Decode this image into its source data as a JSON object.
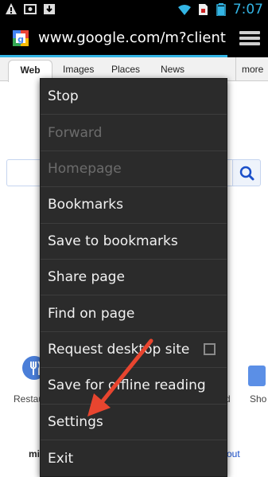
{
  "status_bar": {
    "time": "7:07",
    "icons": [
      "warning-icon",
      "photo-icon",
      "download-icon",
      "wifi-icon",
      "sim-icon",
      "battery-icon"
    ]
  },
  "url_bar": {
    "url": "www.google.com/m?client=ms",
    "favicon": "google-favicon-icon",
    "menu_icon": "overflow-menu-icon"
  },
  "google_tabs": {
    "items": [
      "Web",
      "Images",
      "Places",
      "News"
    ],
    "more": "more"
  },
  "background_text": {
    "left_label": "Restau",
    "right_label_1": "d",
    "right_label_2": "Sho",
    "bottom_left": "mi",
    "bottom_right": "out"
  },
  "menu": {
    "items": [
      {
        "label": "Stop",
        "enabled": true
      },
      {
        "label": "Forward",
        "enabled": false
      },
      {
        "label": "Homepage",
        "enabled": false
      },
      {
        "label": "Bookmarks",
        "enabled": true
      },
      {
        "label": "Save to bookmarks",
        "enabled": true
      },
      {
        "label": "Share page",
        "enabled": true
      },
      {
        "label": "Find on page",
        "enabled": true
      },
      {
        "label": "Request desktop site",
        "enabled": true,
        "checkbox": false
      },
      {
        "label": "Save for offline reading",
        "enabled": true
      },
      {
        "label": "Settings",
        "enabled": true
      },
      {
        "label": "Exit",
        "enabled": true
      }
    ]
  },
  "colors": {
    "accent": "#33b5e5",
    "menu_bg": "#2b2b2b",
    "arrow": "#e8452f"
  }
}
